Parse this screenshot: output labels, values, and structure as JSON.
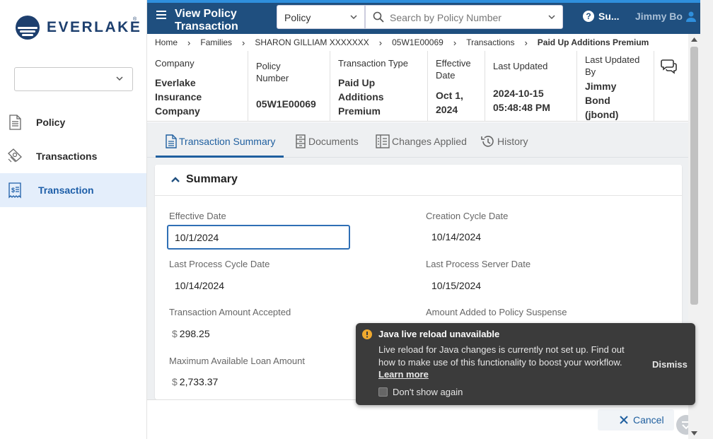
{
  "brand": {
    "name": "EVERLAKE",
    "reg": "®"
  },
  "sidebar": {
    "select_value": "",
    "items": [
      {
        "label": "Policy",
        "icon": "document-icon"
      },
      {
        "label": "Transactions",
        "icon": "transactions-icon"
      },
      {
        "label": "Transaction",
        "icon": "receipt-icon",
        "active": true
      }
    ]
  },
  "topbar": {
    "title_line1": "View Policy",
    "title_line2": "Transaction",
    "search_type": "Policy",
    "search_placeholder": "Search by Policy Number",
    "help_label": "Su...",
    "user_name": "Jimmy Bo"
  },
  "breadcrumb": [
    "Home",
    "Families",
    "SHARON GILLIAM XXXXXXX",
    "05W1E00069",
    "Transactions",
    "Paid Up Additions Premium"
  ],
  "info": {
    "company_label": "Company",
    "company_lines": [
      "Everlake",
      "Insurance",
      "Company"
    ],
    "policy_label_lines": [
      "Policy",
      "Number"
    ],
    "policy_value": "05W1E00069",
    "type_label": "Transaction Type",
    "type_lines": [
      "Paid Up",
      "Additions",
      "Premium"
    ],
    "eff_label_lines": [
      "Effective",
      "Date"
    ],
    "eff_lines": [
      "Oct 1,",
      "2024"
    ],
    "updated_label": "Last Updated",
    "updated_lines": [
      "2024-10-15",
      "05:48:48 PM"
    ],
    "updby_label_lines": [
      "Last Updated",
      "By"
    ],
    "updby_lines": [
      "Jimmy",
      "Bond",
      "(jbond)"
    ]
  },
  "tabs": [
    {
      "label": "Transaction Summary",
      "icon": "document-icon",
      "active": true
    },
    {
      "label": "Documents",
      "icon": "file-cabinet-icon"
    },
    {
      "label": "Changes Applied",
      "icon": "checklist-icon"
    },
    {
      "label": "History",
      "icon": "history-icon"
    }
  ],
  "summary": {
    "title": "Summary",
    "effective_date_label": "Effective Date",
    "effective_date_value": "10/1/2024",
    "creation_cycle_label": "Creation Cycle Date",
    "creation_cycle_value": "10/14/2024",
    "last_process_cycle_label": "Last Process Cycle Date",
    "last_process_cycle_value": "10/14/2024",
    "last_process_server_label": "Last Process Server Date",
    "last_process_server_value": "10/15/2024",
    "amount_accepted_label": "Transaction Amount Accepted",
    "amount_accepted_value": "298.25",
    "amount_suspense_label": "Amount Added to Policy Suspense",
    "max_loan_label": "Maximum Available Loan Amount",
    "max_loan_value": "2,733.37",
    "currency_symbol": "$"
  },
  "footer": {
    "cancel_label": "Cancel"
  },
  "toast": {
    "title": "Java live reload unavailable",
    "message": "Live reload for Java changes is currently not set up. Find out how to make use of this functionality to boost your workflow.",
    "link": "Learn more",
    "checkbox_label": "Don't show again",
    "dismiss": "Dismiss"
  },
  "colors": {
    "topbar": "#1f4f7f",
    "accent": "#2f8fdd",
    "active_nav_bg": "#e4eefb",
    "toast_bg": "#3b3b3b"
  }
}
